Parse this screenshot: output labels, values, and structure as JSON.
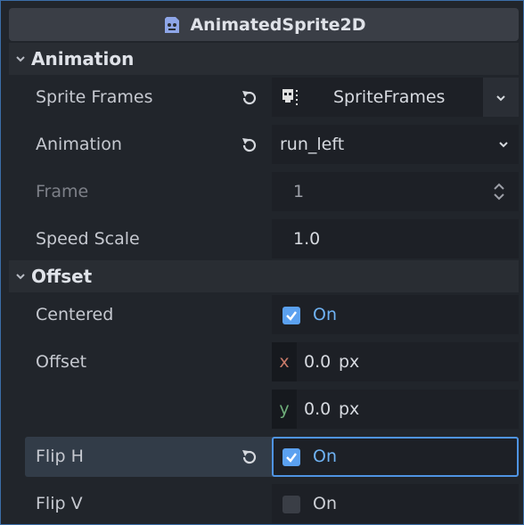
{
  "header": {
    "title": "AnimatedSprite2D"
  },
  "sections": {
    "animation": {
      "label": "Animation"
    },
    "offset": {
      "label": "Offset"
    }
  },
  "props": {
    "sprite_frames": {
      "label": "Sprite Frames",
      "value": "SpriteFrames"
    },
    "animation": {
      "label": "Animation",
      "value": "run_left"
    },
    "frame": {
      "label": "Frame",
      "value": "1"
    },
    "speed_scale": {
      "label": "Speed Scale",
      "value": "1.0"
    },
    "centered": {
      "label": "Centered",
      "value": "On",
      "checked": true
    },
    "offset": {
      "label": "Offset",
      "x_axis": "x",
      "x_value": "0.0",
      "y_axis": "y",
      "y_value": "0.0",
      "unit": "px"
    },
    "flip_h": {
      "label": "Flip H",
      "value": "On",
      "checked": true
    },
    "flip_v": {
      "label": "Flip V",
      "value": "On",
      "checked": false
    }
  },
  "colors": {
    "accent": "#5ba1f0",
    "axis_x": "#c87a69",
    "axis_y": "#6fae7a"
  },
  "icons": {
    "node": "animated-sprite-icon",
    "revert": "revert-icon",
    "sprite_frames": "sprite-frames-icon",
    "dropdown": "chevron-down-icon",
    "spin": "spin-arrows-icon"
  }
}
